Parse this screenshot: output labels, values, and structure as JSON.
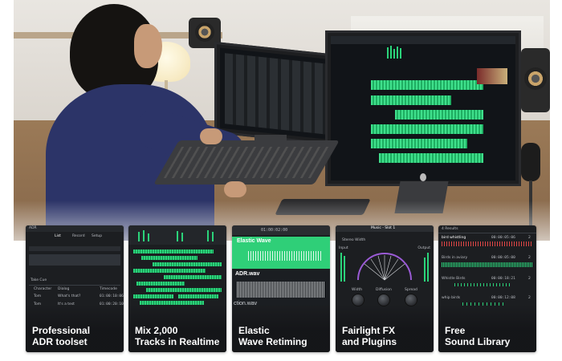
{
  "hero": {
    "left_monitor_label": "",
    "right_monitor_label": ""
  },
  "cards": [
    {
      "id": "adr",
      "caption_line1": "Professional",
      "caption_line2": "ADR toolset",
      "ui": {
        "title": "ADR",
        "tabs": [
          "List",
          "Record",
          "Setup"
        ],
        "list_header": "Take Cue",
        "columns": [
          "Character",
          "Dialog",
          "Timecode"
        ],
        "rows": [
          {
            "character": "Tom",
            "dialog": "What's that?",
            "timecode": "01:00:10:06"
          },
          {
            "character": "Tom",
            "dialog": "It's a test",
            "timecode": "01:00:20:10"
          }
        ]
      }
    },
    {
      "id": "mix",
      "caption_line1": "Mix 2,000",
      "caption_line2": "Tracks in Realtime"
    },
    {
      "id": "elastic",
      "caption_line1": "Elastic",
      "caption_line2": "Wave Retiming",
      "ui": {
        "timecode": "01:00:02:00",
        "clip_top": "Elastic Wave",
        "clip_mid": "ADR.wav",
        "clip_bottom": "ction.wav"
      }
    },
    {
      "id": "fx",
      "caption_line1": "Fairlight FX",
      "caption_line2": "and Plugins",
      "ui": {
        "window_title": "Music - Slot 1",
        "plugin_name": "Stereo Width",
        "labels": [
          "Input",
          "Output"
        ],
        "knobs": [
          "Width",
          "Diffusion",
          "Spread"
        ]
      }
    },
    {
      "id": "library",
      "caption_line1": "Free",
      "caption_line2": "Sound Library",
      "ui": {
        "header": "4 Results",
        "items": [
          {
            "name": "bird whistling",
            "time": "00:00:05:06",
            "ch": "2"
          },
          {
            "name": "Birds in aviary",
            "time": "00:00:05:00",
            "ch": "2"
          },
          {
            "name": "Whistle Birds",
            "time": "00:00:18:21",
            "ch": "2"
          },
          {
            "name": "whip birds",
            "time": "00:00:12:08",
            "ch": "2"
          }
        ]
      }
    }
  ],
  "colors": {
    "card_bg": "#1c1e21",
    "accent_green": "#2bd37a",
    "caption_text": "#ffffff"
  }
}
